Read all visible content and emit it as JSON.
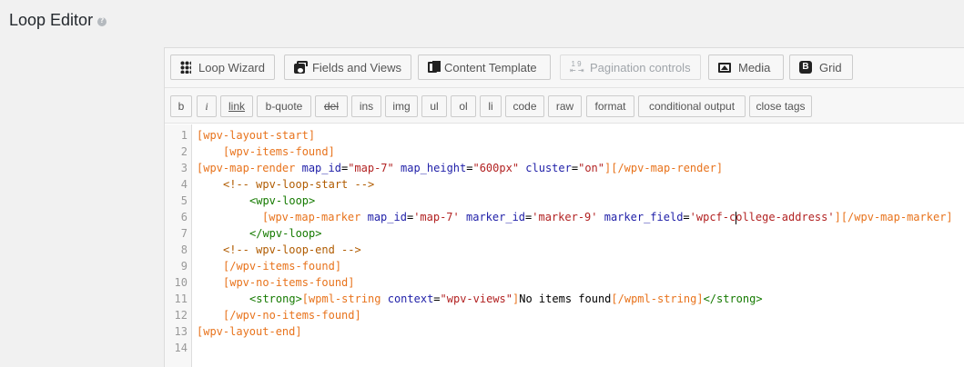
{
  "page": {
    "title": "Loop Editor"
  },
  "toolbar": {
    "buttons": [
      {
        "label": "Loop Wizard",
        "icon": "grid-icon"
      },
      {
        "label": "Fields and Views",
        "icon": "fields-icon"
      },
      {
        "label": "Content Template",
        "icon": "content-template-icon"
      },
      {
        "label": "Pagination controls",
        "icon": "pagination-icon",
        "icon_text": "1 9\n⇤ ⇥"
      },
      {
        "label": "Media",
        "icon": "media-icon"
      },
      {
        "label": "Grid",
        "icon": "bootstrap-icon",
        "icon_text": "B"
      }
    ]
  },
  "quicktags": [
    "b",
    "i",
    "link",
    "b-quote",
    "del",
    "ins",
    "img",
    "ul",
    "ol",
    "li",
    "code",
    "raw",
    "format",
    "conditional output",
    "close tags"
  ],
  "code": {
    "line_numbers": [
      "1",
      "2",
      "3",
      "4",
      "5",
      "6",
      "7",
      "8",
      "9",
      "10",
      "11",
      "12",
      "13",
      "14"
    ],
    "l1": "[wpv-layout-start]",
    "l2": "[wpv-items-found]",
    "l3a": "[wpv-map-render",
    "l3b": " map_id",
    "l3c": "=",
    "l3d": "\"map-7\"",
    "l3e": " map_height",
    "l3f": "=",
    "l3g": "\"600px\"",
    "l3h": " cluster",
    "l3i": "=",
    "l3j": "\"on\"",
    "l3k": "][/wpv-map-render]",
    "l4": "<!-- wpv-loop-start -->",
    "l5": "<wpv-loop>",
    "l6a": "[wpv-map-marker",
    "l6b": " map_id",
    "l6c": "=",
    "l6d": "'map-7'",
    "l6e": " marker_id",
    "l6f": "=",
    "l6g": "'marker-9'",
    "l6h": " marker_field",
    "l6i": "=",
    "l6j1": "'wpcf-c",
    "l6j2": "ollege-address'",
    "l6k": "][/wpv-map-marker]",
    "l7": "</wpv-loop>",
    "l8": "<!-- wpv-loop-end -->",
    "l9": "[/wpv-items-found]",
    "l10": "[wpv-no-items-found]",
    "l11a": "<strong>",
    "l11b": "[wpml-string",
    "l11c": " context",
    "l11d": "=",
    "l11e": "\"wpv-views\"",
    "l11f": "]",
    "l11g": "No items found",
    "l11h": "[/wpml-string]",
    "l11i": "</strong>",
    "l12": "[/wpv-no-items-found]",
    "l13": "[wpv-layout-end]"
  }
}
